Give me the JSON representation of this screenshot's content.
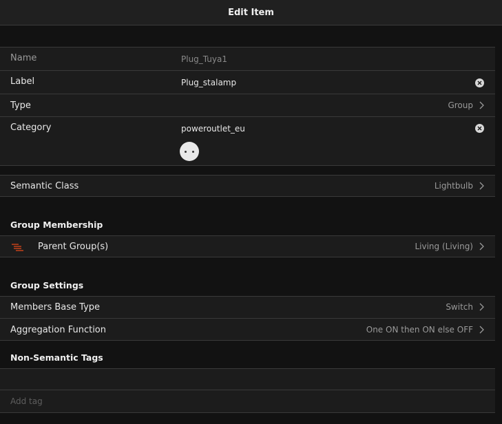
{
  "navbar": {
    "title": "Edit Item"
  },
  "item": {
    "name_label": "Name",
    "name_value": "Plug_Tuya1",
    "label_label": "Label",
    "label_value": "Plug_stalamp",
    "type_label": "Type",
    "type_value": "Group",
    "category_label": "Category",
    "category_value": "poweroutlet_eu",
    "category_icon": "poweroutlet-eu-icon"
  },
  "semantic": {
    "label": "Semantic Class",
    "value": "Lightbulb"
  },
  "group_membership": {
    "title": "Group Membership",
    "parent_label": "Parent Group(s)",
    "parent_value": "Living (Living)",
    "icon": "group-list-icon",
    "accent": "#e64a19"
  },
  "group_settings": {
    "title": "Group Settings",
    "base_type_label": "Members Base Type",
    "base_type_value": "Switch",
    "aggregation_label": "Aggregation Function",
    "aggregation_value": "One ON then ON else OFF"
  },
  "tags": {
    "title": "Non-Semantic Tags",
    "add_placeholder": "Add tag"
  }
}
